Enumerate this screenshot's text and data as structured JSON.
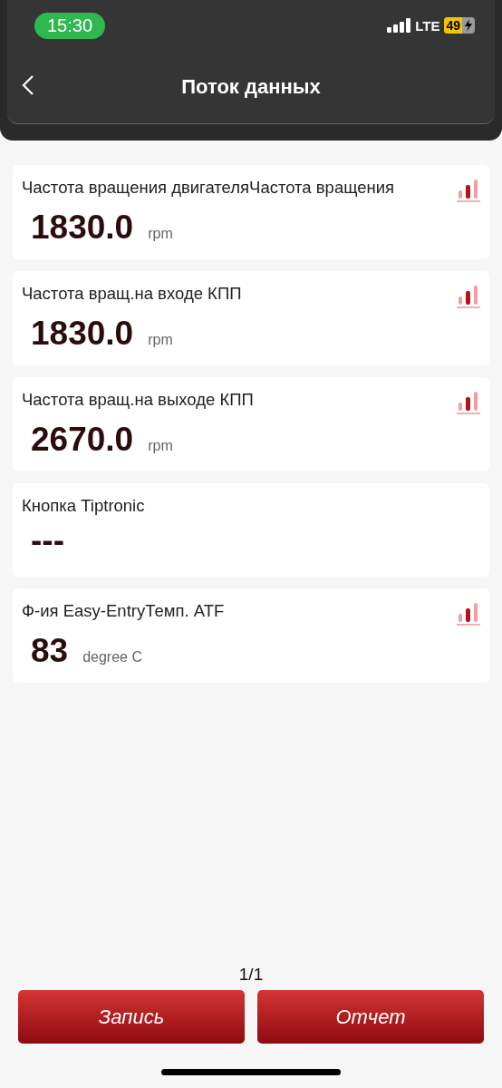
{
  "status_bar": {
    "time": "15:30",
    "network": "LTE",
    "battery": "49"
  },
  "header": {
    "title": "Поток данных"
  },
  "items": [
    {
      "name": "Частота вращения двигателяЧастота вращения",
      "value": "1830.0",
      "unit": "rpm",
      "chart": true
    },
    {
      "name": "Частота вращ.на входе КПП",
      "value": "1830.0",
      "unit": "rpm",
      "chart": true
    },
    {
      "name": "Частота вращ.на выходе КПП",
      "value": "2670.0",
      "unit": "rpm",
      "chart": true
    },
    {
      "name": "Кнопка Tiptronic",
      "value": "---",
      "chart": false
    },
    {
      "name": "Ф-ия Easy-EntryТемп. ATF",
      "value": "83",
      "unit": "degree C",
      "chart": true
    }
  ],
  "pager": "1/1",
  "buttons": [
    "Запись",
    "Отчет"
  ]
}
